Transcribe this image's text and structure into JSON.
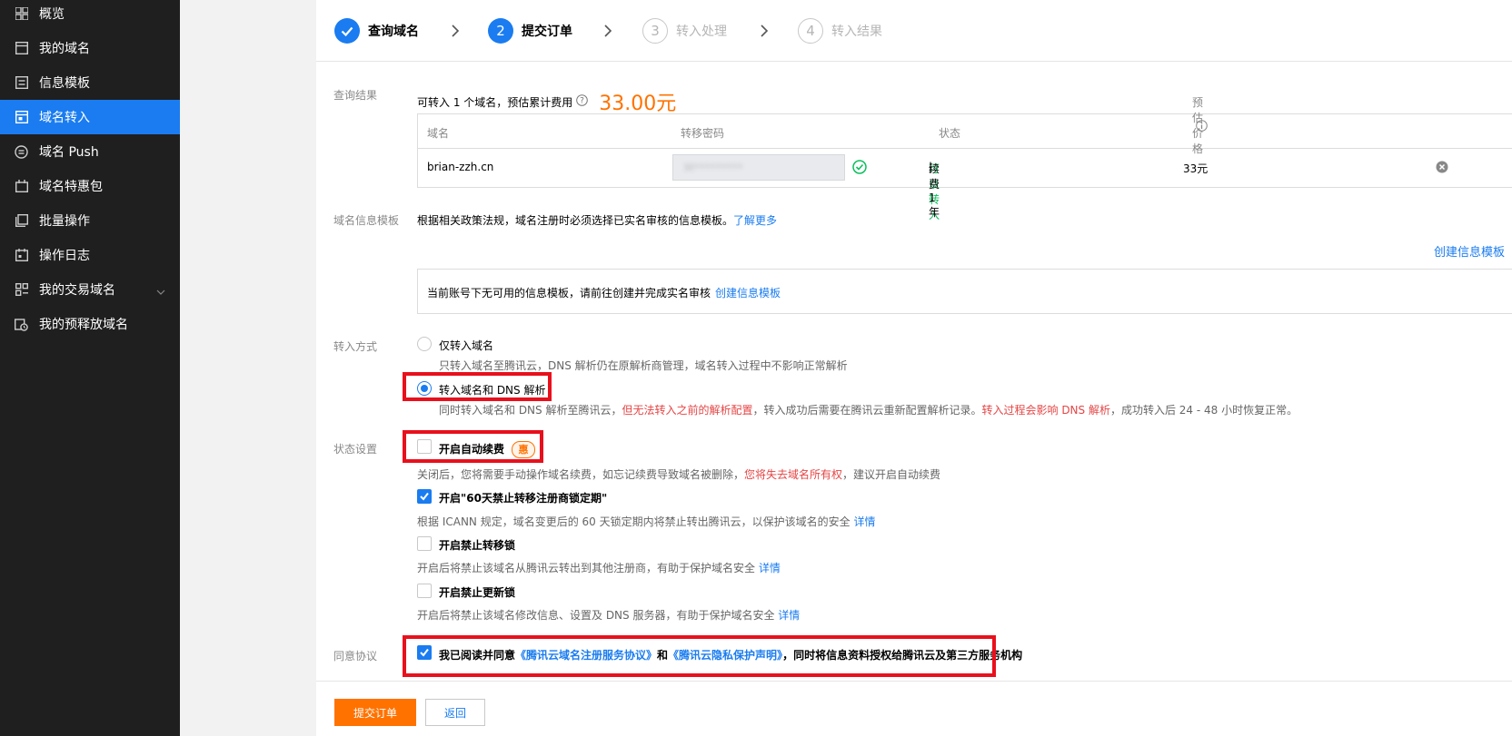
{
  "sidebar": {
    "items": [
      {
        "label": "概览",
        "icon": "grid-icon"
      },
      {
        "label": "我的域名",
        "icon": "domain-icon"
      },
      {
        "label": "信息模板",
        "icon": "template-icon"
      },
      {
        "label": "域名转入",
        "icon": "transfer-icon"
      },
      {
        "label": "域名 Push",
        "icon": "push-icon"
      },
      {
        "label": "域名特惠包",
        "icon": "package-icon"
      },
      {
        "label": "批量操作",
        "icon": "batch-icon"
      },
      {
        "label": "操作日志",
        "icon": "log-icon"
      },
      {
        "label": "我的交易域名",
        "icon": "trade-icon"
      },
      {
        "label": "我的预释放域名",
        "icon": "release-icon"
      }
    ]
  },
  "steps": [
    {
      "num": "",
      "label": "查询域名"
    },
    {
      "num": "2",
      "label": "提交订单"
    },
    {
      "num": "3",
      "label": "转入处理"
    },
    {
      "num": "4",
      "label": "转入结果"
    }
  ],
  "query": {
    "label": "查询结果",
    "summary": "可转入 1 个域名，预估累计费用",
    "total_price": "33.00元",
    "table": {
      "headers": [
        "域名",
        "转移密码",
        "状态",
        "预估价格"
      ],
      "row": {
        "domain": "brian-zzh.cn",
        "auth_code": "M*********",
        "status_ok": "可以转入",
        "status_sep": " | ",
        "status_renew": "续费1年",
        "price": "33元"
      }
    }
  },
  "template": {
    "label": "域名信息模板",
    "notice": "根据相关政策法规，域名注册时必须选择已实名审核的信息模板。",
    "learn_more": "了解更多",
    "create_link": "创建信息模板",
    "empty_text": "当前账号下无可用的信息模板，请前往创建并完成实名审核",
    "empty_link": "创建信息模板"
  },
  "mode": {
    "label": "转入方式",
    "opt1_label": "仅转入域名",
    "opt1_desc": "只转入域名至腾讯云，DNS 解析仍在原解析商管理，域名转入过程中不影响正常解析",
    "opt2_label": "转入域名和 DNS 解析",
    "opt2_desc_a": "同时转入域名和 DNS 解析至腾讯云，",
    "opt2_desc_b": "但无法转入之前的解析配置",
    "opt2_desc_c": "，转入成功后需要在腾讯云重新配置解析记录。",
    "opt2_desc_d": "转入过程会影响 DNS 解析",
    "opt2_desc_e": "，成功转入后 24 - 48 小时恢复正常。"
  },
  "status": {
    "label": "状态设置",
    "auto_renew_label": "开启自动续费",
    "hui": "惠",
    "auto_renew_desc_a": "关闭后，您将需要手动操作域名续费，如忘记续费导致域名被删除，",
    "auto_renew_desc_b": "您将失去域名所有权",
    "auto_renew_desc_c": "，建议开启自动续费",
    "lock60_label": "开启\"60天禁止转移注册商锁定期\"",
    "lock60_desc": "根据 ICANN 规定，域名变更后的 60 天锁定期内将禁止转出腾讯云，以保护该域名的安全",
    "lock60_detail": "详情",
    "transfer_lock_label": "开启禁止转移锁",
    "transfer_lock_desc": "开启后将禁止该域名从腾讯云转出到其他注册商，有助于保护域名安全",
    "transfer_lock_detail": "详情",
    "update_lock_label": "开启禁止更新锁",
    "update_lock_desc": "开启后将禁止该域名修改信息、设置及 DNS 服务器，有助于保护域名安全",
    "update_lock_detail": "详情"
  },
  "agreement": {
    "label": "同意协议",
    "text_a": "我已阅读并同意",
    "link1": "《腾讯云域名注册服务协议》",
    "text_b": "和",
    "link2": "《腾讯云隐私保护声明》",
    "text_c": "，同时将信息资料授权给腾讯云及第三方服务机构"
  },
  "actions": {
    "submit": "提交订单",
    "back": "返回"
  },
  "colors": {
    "accent": "#1a7cf0",
    "orange": "#ff7200",
    "highlight": "#e8101c",
    "success": "#0abf5b",
    "sidebar": "#1f1f1f"
  }
}
